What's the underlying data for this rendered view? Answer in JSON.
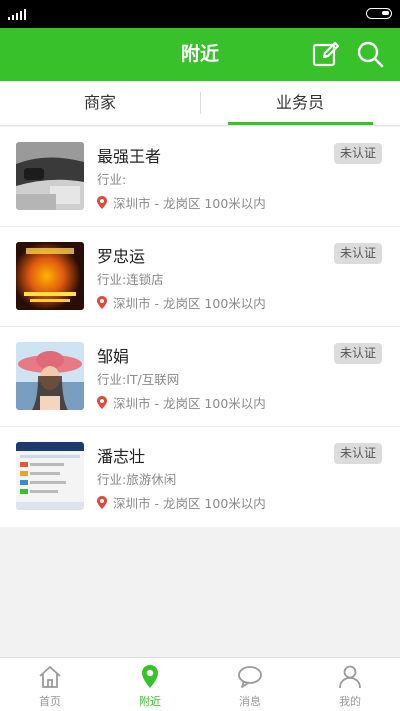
{
  "header": {
    "title": "附近"
  },
  "tabs": {
    "merchants": "商家",
    "salesmen": "业务员"
  },
  "colors": {
    "brand": "#38c12b",
    "pin": "#e04a3c",
    "badge_bg": "#dcdcdc"
  },
  "list": {
    "items": [
      {
        "name": "最强王者",
        "industry": "行业:",
        "location": "深圳市 - 龙岗区 100米以内",
        "badge": "未认证",
        "avatar": "car-interior-photo"
      },
      {
        "name": "罗忠运",
        "industry": "行业:连锁店",
        "location": "深圳市 - 龙岗区 100米以内",
        "badge": "未认证",
        "avatar": "orange-poster-photo"
      },
      {
        "name": "邹娟",
        "industry": "行业:IT/互联网",
        "location": "深圳市 - 龙岗区 100米以内",
        "badge": "未认证",
        "avatar": "woman-hat-photo"
      },
      {
        "name": "潘志壮",
        "industry": "行业:旅游休闲",
        "location": "深圳市 - 龙岗区 100米以内",
        "badge": "未认证",
        "avatar": "app-screenshot-photo"
      }
    ]
  },
  "nav": {
    "home": "首页",
    "nearby": "附近",
    "messages": "消息",
    "mine": "我的"
  },
  "icons": {
    "edit": "edit-icon",
    "search": "search-icon",
    "pin": "location-pin-icon",
    "home": "home-icon",
    "nearby": "map-pin-icon",
    "messages": "chat-bubble-icon",
    "mine": "user-icon"
  }
}
